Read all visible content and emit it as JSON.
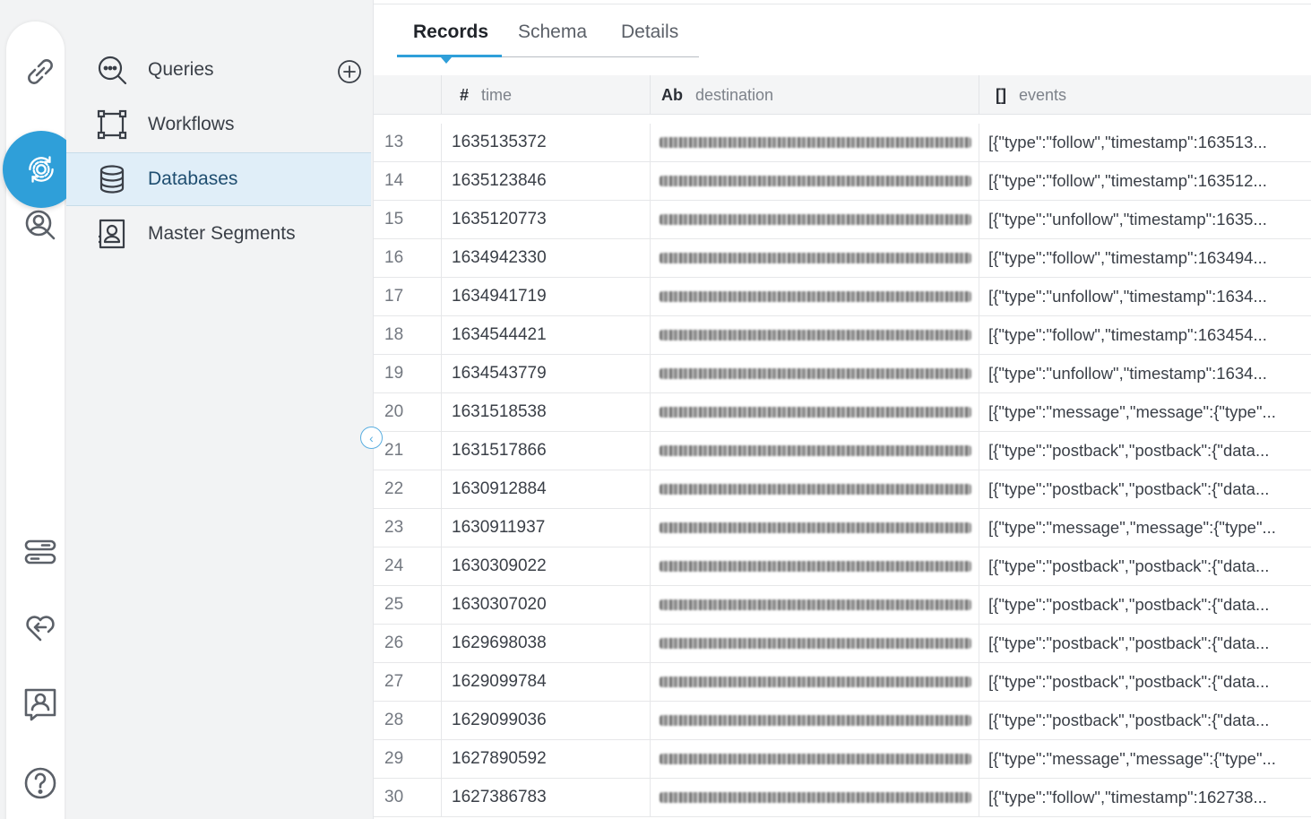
{
  "rail": {
    "icons": [
      "link-icon",
      "data-sync-icon",
      "user-search-icon",
      "toggle-stack-icon",
      "heart-return-icon",
      "contact-card-icon",
      "help-icon"
    ],
    "active": "data-sync-icon",
    "accent": "#2f9fd9"
  },
  "nav": {
    "items": [
      {
        "label": "Queries",
        "icon": "search-icon"
      },
      {
        "label": "Workflows",
        "icon": "workflow-icon"
      },
      {
        "label": "Databases",
        "icon": "database-icon"
      },
      {
        "label": "Master Segments",
        "icon": "segment-icon"
      }
    ],
    "active": "Databases"
  },
  "tabs": [
    {
      "label": "Records",
      "active": true
    },
    {
      "label": "Schema",
      "active": false
    },
    {
      "label": "Details",
      "active": false
    }
  ],
  "columns": [
    {
      "type": "#",
      "name": "time"
    },
    {
      "type": "Ab",
      "name": "destination"
    },
    {
      "type": "[]",
      "name": "events"
    }
  ],
  "rows": [
    {
      "n": "13",
      "time": "1635135372",
      "events": "[{\"type\":\"follow\",\"timestamp\":163513..."
    },
    {
      "n": "14",
      "time": "1635123846",
      "events": "[{\"type\":\"follow\",\"timestamp\":163512..."
    },
    {
      "n": "15",
      "time": "1635120773",
      "events": "[{\"type\":\"unfollow\",\"timestamp\":1635..."
    },
    {
      "n": "16",
      "time": "1634942330",
      "events": "[{\"type\":\"follow\",\"timestamp\":163494..."
    },
    {
      "n": "17",
      "time": "1634941719",
      "events": "[{\"type\":\"unfollow\",\"timestamp\":1634..."
    },
    {
      "n": "18",
      "time": "1634544421",
      "events": "[{\"type\":\"follow\",\"timestamp\":163454..."
    },
    {
      "n": "19",
      "time": "1634543779",
      "events": "[{\"type\":\"unfollow\",\"timestamp\":1634..."
    },
    {
      "n": "20",
      "time": "1631518538",
      "events": "[{\"type\":\"message\",\"message\":{\"type\"..."
    },
    {
      "n": "21",
      "time": "1631517866",
      "events": "[{\"type\":\"postback\",\"postback\":{\"data..."
    },
    {
      "n": "22",
      "time": "1630912884",
      "events": "[{\"type\":\"postback\",\"postback\":{\"data..."
    },
    {
      "n": "23",
      "time": "1630911937",
      "events": "[{\"type\":\"message\",\"message\":{\"type\"..."
    },
    {
      "n": "24",
      "time": "1630309022",
      "events": "[{\"type\":\"postback\",\"postback\":{\"data..."
    },
    {
      "n": "25",
      "time": "1630307020",
      "events": "[{\"type\":\"postback\",\"postback\":{\"data..."
    },
    {
      "n": "26",
      "time": "1629698038",
      "events": "[{\"type\":\"postback\",\"postback\":{\"data..."
    },
    {
      "n": "27",
      "time": "1629099784",
      "events": "[{\"type\":\"postback\",\"postback\":{\"data..."
    },
    {
      "n": "28",
      "time": "1629099036",
      "events": "[{\"type\":\"postback\",\"postback\":{\"data..."
    },
    {
      "n": "29",
      "time": "1627890592",
      "events": "[{\"type\":\"message\",\"message\":{\"type\"..."
    },
    {
      "n": "30",
      "time": "1627386783",
      "events": "[{\"type\":\"follow\",\"timestamp\":162738..."
    }
  ]
}
